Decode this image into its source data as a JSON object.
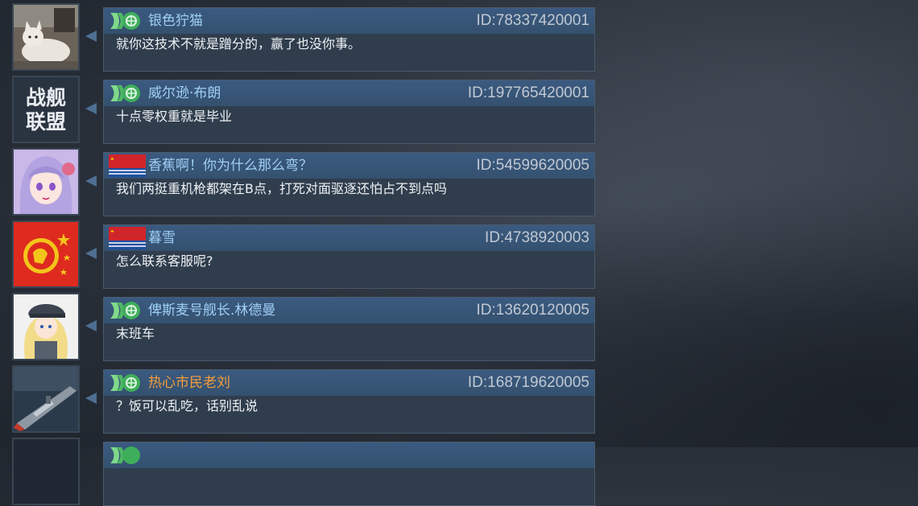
{
  "colors": {
    "bubble_bg": "#2f3d4d",
    "bubble_header": "#3b5a80",
    "username_default": "#9fd0f5",
    "username_highlight": "#f39d3d",
    "id_text": "#c0c8d2",
    "message_text": "#eef1f4"
  },
  "messages": [
    {
      "username": "银色狞猫",
      "player_id": "ID:78337420001",
      "text": "就你这技术不就是蹭分的，赢了也没你事。",
      "badge": "green-alliance-emblem-icon",
      "avatar": "cat-photo-avatar"
    },
    {
      "username": "威尔逊·布朗",
      "player_id": "ID:197765420001",
      "text": "十点零权重就是毕业",
      "badge": "green-alliance-emblem-icon",
      "avatar": "game-logo-avatar",
      "avatar_text": [
        "战舰",
        "联盟"
      ]
    },
    {
      "username": "香蕉啊！你为什么那么弯？",
      "player_id": "ID:54599620005",
      "text": "我们两挺重机枪都架在B点，打死对面驱逐还怕占不到点吗",
      "badge": "naval-ensign-flag-icon",
      "avatar": "anime-girl-avatar"
    },
    {
      "username": "暮雪",
      "player_id": "ID:4738920003",
      "text": "怎么联系客服呢?",
      "badge": "naval-ensign-flag-icon",
      "avatar": "red-star-emblem-avatar"
    },
    {
      "username": "俾斯麦号舰长.林德曼",
      "player_id": "ID:13620120005",
      "text": "末班车",
      "badge": "green-alliance-emblem-icon",
      "avatar": "anime-officer-avatar"
    },
    {
      "username": "热心市民老刘",
      "username_highlight": true,
      "player_id": "ID:168719620005",
      "text": "？饭可以乱吃，话别乱说",
      "badge": "green-alliance-emblem-icon",
      "avatar": "warship-avatar"
    }
  ]
}
